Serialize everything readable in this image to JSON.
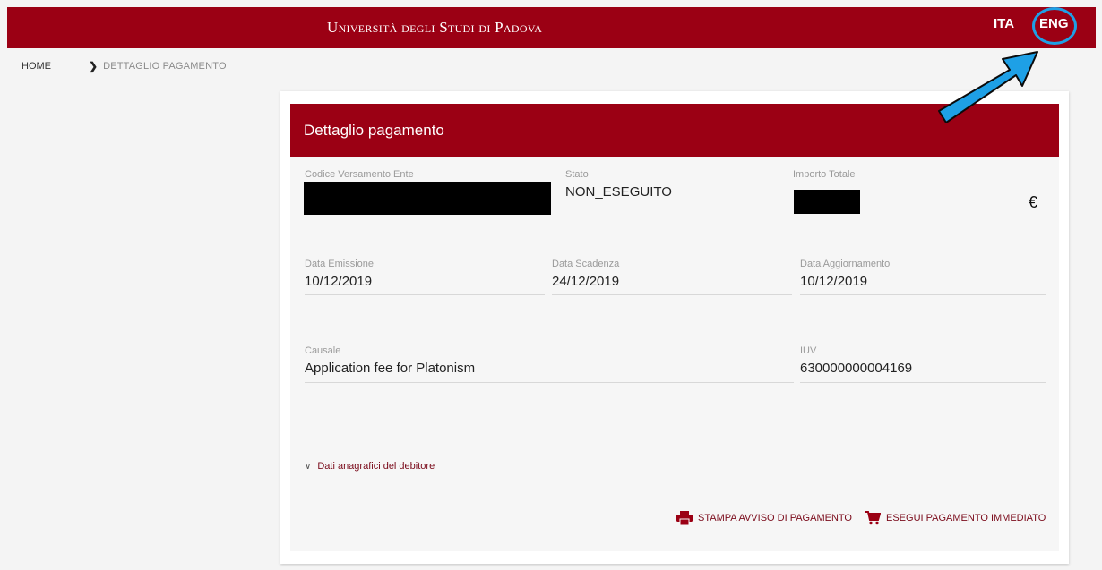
{
  "header": {
    "university": "Università degli Studi di Padova",
    "lang_ita": "ITA",
    "lang_eng": "ENG",
    "accent_color": "#9b0014",
    "annotation_color": "#1ea0e6"
  },
  "breadcrumb": {
    "home": "HOME",
    "current": "DETTAGLIO PAGAMENTO"
  },
  "card": {
    "title": "Dettaglio pagamento",
    "fields": {
      "codice": {
        "label": "Codice Versamento Ente",
        "value": ""
      },
      "stato": {
        "label": "Stato",
        "value": "NON_ESEGUITO"
      },
      "importo": {
        "label": "Importo Totale",
        "value": "",
        "currency": "€"
      },
      "emissione": {
        "label": "Data Emissione",
        "value": "10/12/2019"
      },
      "scadenza": {
        "label": "Data Scadenza",
        "value": "24/12/2019"
      },
      "aggiornamento": {
        "label": "Data Aggiornamento",
        "value": "10/12/2019"
      },
      "causale": {
        "label": "Causale",
        "value": "Application fee for Platonism"
      },
      "iuv": {
        "label": "IUV",
        "value": "630000000004169"
      }
    },
    "expand_label": "Dati anagrafici del debitore",
    "actions": {
      "print": "STAMPA AVVISO DI PAGAMENTO",
      "pay": "ESEGUI PAGAMENTO IMMEDIATO"
    }
  }
}
